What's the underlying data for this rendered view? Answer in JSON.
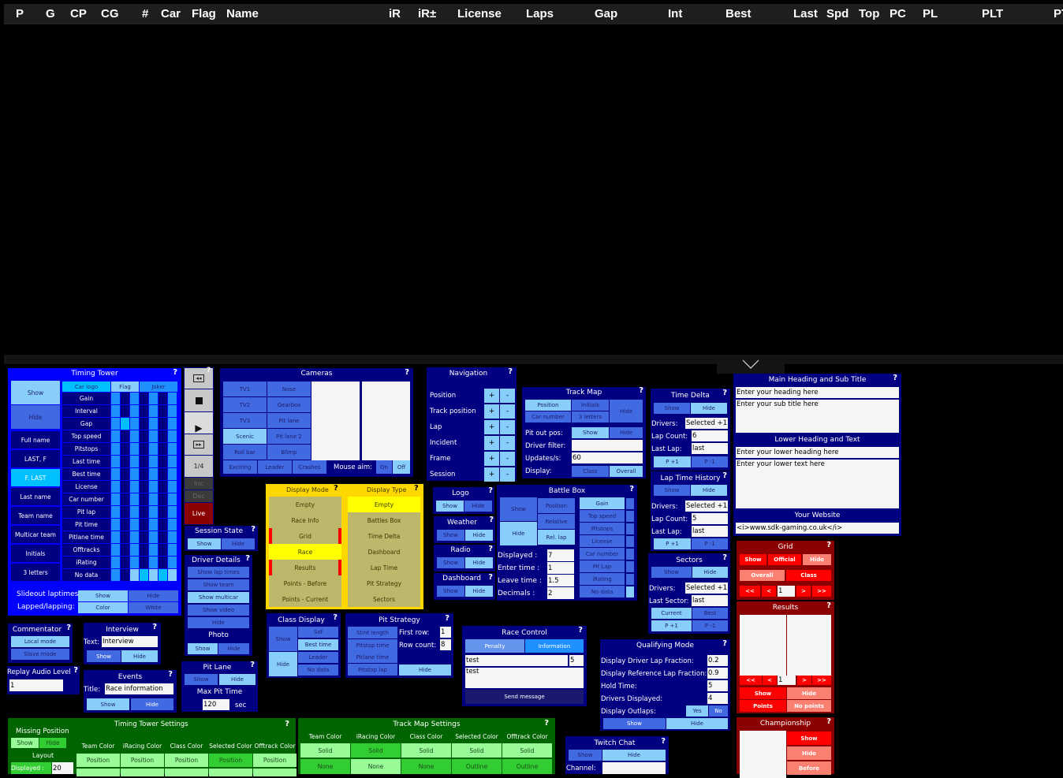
{
  "header_columns": [
    "P",
    "G",
    "CP",
    "CG",
    "#",
    "Car",
    "Flag",
    "Name",
    "iR",
    "iR±",
    "License",
    "Laps",
    "Gap",
    "Int",
    "Best",
    "Last",
    "Spd",
    "Top",
    "PC",
    "PL",
    "PLT",
    "PT"
  ],
  "help": "?",
  "collapse_icon": "chevron-down",
  "timing_tower": {
    "title": "Timing Tower",
    "left_buttons": [
      "Show",
      "Hide",
      "Full name",
      "LAST, F",
      "F. LAST",
      "Last name",
      "Team name",
      "Multicar team",
      "Initials",
      "3 letters"
    ],
    "selected_name_format": "F. LAST",
    "col_headers": [
      "Car logo",
      "Flag",
      "Joker"
    ],
    "rows": [
      "Gain",
      "Interval",
      "Gap",
      "Top speed",
      "Pitstops",
      "Last time",
      "Best time",
      "License",
      "Car number",
      "Pit lap",
      "Pit time",
      "Pitlane time",
      "Offtracks",
      "iRating",
      "No data"
    ],
    "slideout_label": "Slideout laptimes:",
    "slideout_buttons": [
      "Show",
      "Hide"
    ],
    "lapped_label": "Lapped/lapping:",
    "lapped_buttons": [
      "Color",
      "White"
    ]
  },
  "replay": {
    "rewind": "rewind",
    "stop": "stop",
    "play": "play",
    "fast_forward": "fast-forward",
    "speed": "1/4",
    "inc": "Inc",
    "dec": "Dec",
    "live": "Live"
  },
  "cameras": {
    "title": "Cameras",
    "buttons": [
      [
        "TV1",
        "Nose"
      ],
      [
        "TV2",
        "Gearbox"
      ],
      [
        "TV3",
        "Pit lane"
      ],
      [
        "Scenic",
        "Pit lane 2"
      ],
      [
        "Roll bar",
        "Blimp"
      ]
    ],
    "selected": "Scenic",
    "bottom": [
      "Exciting",
      "Leader",
      "Crashes"
    ],
    "mouse_aim_label": "Mouse aim:",
    "mouse_aim": [
      "On",
      "Off"
    ],
    "mouse_aim_value": "Off"
  },
  "navigation": {
    "title": "Navigation",
    "rows": [
      "Position",
      "Track position",
      "Lap",
      "Incident",
      "Frame",
      "Session"
    ],
    "plus": "+",
    "minus": "-"
  },
  "track_map": {
    "title": "Track Map",
    "buttons": [
      "Position",
      "Initials",
      "Car number",
      "3 letters"
    ],
    "hide": "Hide",
    "pit_out_label": "Pit out pos:",
    "pit_out_buttons": [
      "Show",
      "Hide"
    ],
    "driver_filter_label": "Driver filter:",
    "driver_filter": "",
    "updates_label": "Updates/s:",
    "updates": "60",
    "display_label": "Display:",
    "display_buttons": [
      "Class",
      "Overall"
    ]
  },
  "time_delta": {
    "title": "Time Delta",
    "buttons": [
      "Show",
      "Hide"
    ],
    "drivers_label": "Drivers:",
    "drivers": "Selected +1",
    "lap_count_label": "Lap Count:",
    "lap_count": "6",
    "last_lap_label": "Last Lap:",
    "last_lap": "last",
    "p_buttons": [
      "P +1",
      "P -1"
    ]
  },
  "lap_time_history": {
    "title": "Lap Time History",
    "buttons": [
      "Show",
      "Hide"
    ],
    "drivers_label": "Drivers:",
    "drivers": "Selected +1",
    "lap_count_label": "Lap Count:",
    "lap_count": "5",
    "last_lap_label": "Last Lap:",
    "last_lap": "last",
    "p_buttons": [
      "P +1",
      "P -1"
    ]
  },
  "sectors": {
    "title": "Sectors",
    "buttons": [
      "Show",
      "Hide"
    ],
    "drivers_label": "Drivers:",
    "drivers": "Selected +1",
    "last_sector_label": "Last Sector:",
    "last_sector": "last",
    "mode_buttons": [
      "Current",
      "Best"
    ],
    "p_buttons": [
      "P +1",
      "P -1"
    ]
  },
  "headings": {
    "title": "Main Heading and Sub Title",
    "heading": "Enter your heading here",
    "subtitle": "Enter your sub title here",
    "lower_title": "Lower Heading and Text",
    "lower_heading": "Enter your lower heading here",
    "lower_text": "Enter your lower text here",
    "website_title": "Your Website",
    "website": "<i>www.sdk-gaming.co.uk</i>"
  },
  "display_mode": {
    "title": "Display Mode",
    "items": [
      "Empty",
      "Race Info",
      "Grid",
      "Race",
      "Results",
      "Points - Before",
      "Points - Current"
    ],
    "selected": "Race"
  },
  "display_type": {
    "title": "Display Type",
    "items": [
      "Empty",
      "Battles Box",
      "Time Delta",
      "Dashboard",
      "Lap Time",
      "Pit Strategy",
      "Sectors"
    ],
    "selected": "Empty"
  },
  "session_state": {
    "title": "Session State",
    "buttons": [
      "Show",
      "Hide"
    ]
  },
  "driver_details": {
    "title": "Driver Details",
    "buttons": [
      "Show lap times",
      "Show team",
      "Show multicar",
      "Show video",
      "Hide"
    ],
    "photo_title": "Photo",
    "photo_buttons": [
      "Show",
      "Hide"
    ]
  },
  "logo": {
    "title": "Logo",
    "buttons": [
      "Show",
      "Hide"
    ]
  },
  "weather": {
    "title": "Weather",
    "buttons": [
      "Show",
      "Hide"
    ]
  },
  "radio": {
    "title": "Radio",
    "buttons": [
      "Show",
      "Hide"
    ]
  },
  "dashboard": {
    "title": "Dashboard",
    "buttons": [
      "Show",
      "Hide"
    ]
  },
  "battle_box": {
    "title": "Battle Box",
    "show": "Show",
    "hide": "Hide",
    "modes": [
      "Position",
      "Relative",
      "Rel. lap"
    ],
    "fields": [
      "Gain",
      "Top speed",
      "Pitstops",
      "License",
      "Car number",
      "Pit Lap",
      "iRating",
      "No data"
    ],
    "displayed_label": "Displayed :",
    "displayed": "7",
    "enter_label": "Enter time :",
    "enter": "1",
    "leave_label": "Leave time :",
    "leave": "1.5",
    "decimals_label": "Decimals :",
    "decimals": "2"
  },
  "grid": {
    "title": "Grid",
    "buttons": [
      "Show",
      "Official",
      "Hide"
    ],
    "scope": [
      "Overall",
      "Class"
    ],
    "nav": [
      "<<",
      "<",
      ">",
      ">>"
    ],
    "page": "1"
  },
  "results": {
    "title": "Results",
    "nav": [
      "<<",
      "<",
      ">",
      ">>"
    ],
    "page": "1",
    "buttons": [
      "Show",
      "Hide"
    ],
    "points": [
      "Points",
      "No points"
    ]
  },
  "championship": {
    "title": "Championship",
    "buttons": [
      "Show",
      "Hide",
      "Before"
    ]
  },
  "commentator": {
    "title": "Commentator",
    "buttons": [
      "Local mode",
      "Slave mode"
    ]
  },
  "interview": {
    "title": "Interview",
    "text_label": "Text:",
    "text": "Interview",
    "buttons": [
      "Show",
      "Hide"
    ]
  },
  "replay_audio": {
    "title": "Replay Audio Level",
    "value": "1"
  },
  "events": {
    "title": "Events",
    "title_label": "Title:",
    "value": "Race information",
    "buttons": [
      "Show",
      "Hide"
    ]
  },
  "pit_lane": {
    "title": "Pit Lane",
    "buttons": [
      "Show",
      "Hide"
    ],
    "max_label": "Max Pit Time",
    "max": "120",
    "unit": "sec"
  },
  "class_display": {
    "title": "Class Display",
    "show": "Show",
    "hide": "Hide",
    "options": [
      "Sof",
      "Best time",
      "Leader",
      "No data"
    ]
  },
  "pit_strategy": {
    "title": "Pit Strategy",
    "options": [
      "Stint length",
      "Pitstop time",
      "Pitlane time",
      "Pitstop lap"
    ],
    "first_row_label": "First row:",
    "first_row": "1",
    "row_count_label": "Row count:",
    "row_count": "8",
    "hide": "Hide"
  },
  "race_control": {
    "title": "Race Control",
    "tabs": [
      "Penalty",
      "Information"
    ],
    "message_line": "test",
    "number": "5",
    "message_body": "test",
    "send": "Send message"
  },
  "qualifying": {
    "title": "Qualifying Mode",
    "rows": [
      {
        "label": "Display Driver Lap Fraction:",
        "value": "0.2"
      },
      {
        "label": "Display Reference Lap Fraction:",
        "value": "0.9"
      },
      {
        "label": "Hold Time:",
        "value": "5"
      },
      {
        "label": "Drivers Displayed:",
        "value": "4"
      }
    ],
    "outlaps_label": "Display Outlaps:",
    "outlaps": [
      "Yes",
      "No"
    ],
    "buttons": [
      "Show",
      "Hide"
    ]
  },
  "twitch": {
    "title": "Twitch Chat",
    "buttons": [
      "Show",
      "Hide"
    ],
    "channel_label": "Channel:",
    "channel": ""
  },
  "tt_settings": {
    "title": "Timing Tower Settings",
    "missing_title": "Missing Position",
    "missing_buttons": [
      "Show",
      "Hide"
    ],
    "layout_title": "Layout",
    "displayed_label": "Displayed :",
    "displayed": "20",
    "columns": [
      "Team Color",
      "iRacing Color",
      "Class Color",
      "Selected Color",
      "Offtrack Color"
    ],
    "row1": [
      "Position",
      "Position",
      "Position",
      "Position",
      "Position"
    ]
  },
  "tm_settings": {
    "title": "Track Map Settings",
    "columns": [
      "Team Color",
      "iRacing Color",
      "Class Color",
      "Selected Color",
      "Offtrack Color"
    ],
    "row1": [
      "Solid",
      "Solid",
      "Solid",
      "Solid",
      "Solid"
    ],
    "row2": [
      "None",
      "None",
      "None",
      "Outline",
      "Outline"
    ]
  }
}
